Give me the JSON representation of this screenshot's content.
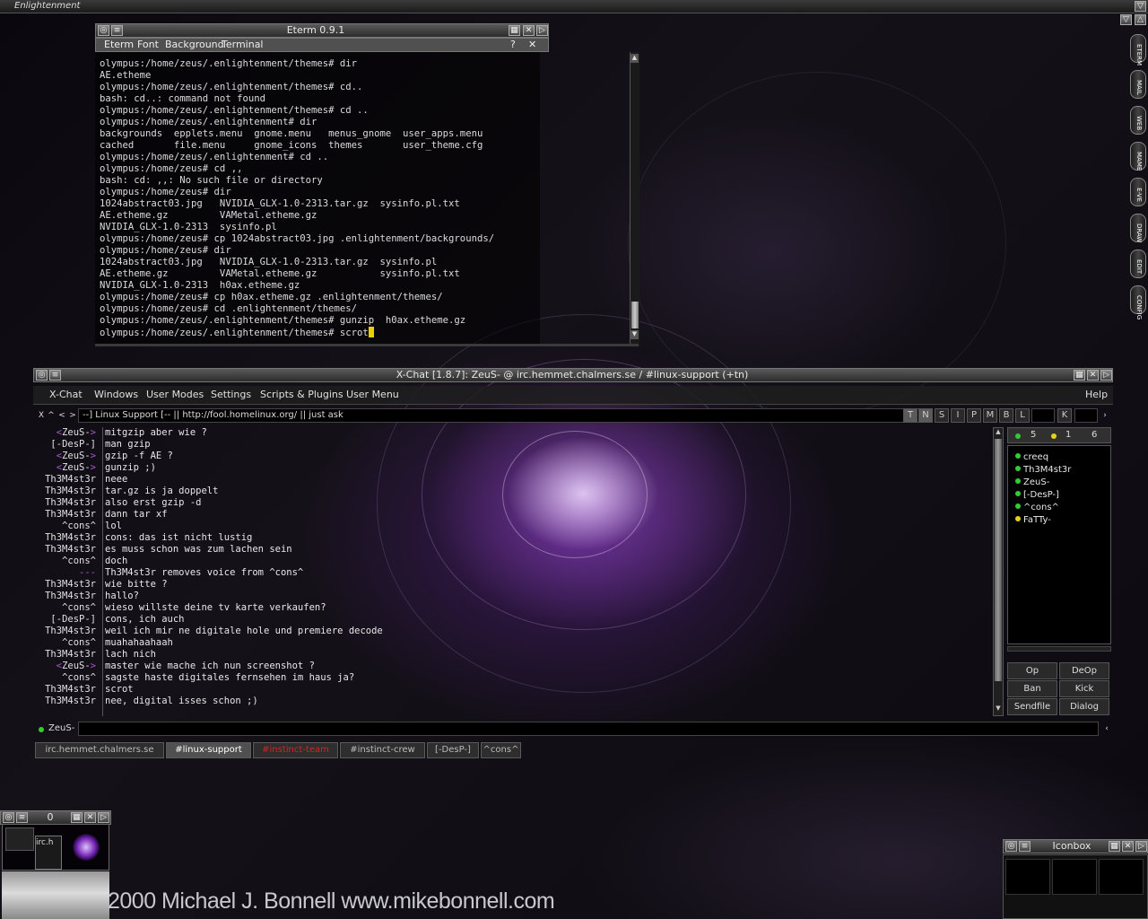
{
  "desktop": {
    "title": "Enlightenment",
    "copyright": "2000 Michael J. Bonnell  www.mikebonnell.com"
  },
  "eterm": {
    "title": "Eterm 0.9.1",
    "menu": [
      "Eterm",
      "Font",
      "Background",
      "Terminal"
    ],
    "menu_help": "?",
    "lines": [
      "olympus:/home/zeus/.enlightenment/themes# dir",
      "AE.etheme",
      "olympus:/home/zeus/.enlightenment/themes# cd..",
      "bash: cd..: command not found",
      "olympus:/home/zeus/.enlightenment/themes# cd ..",
      "olympus:/home/zeus/.enlightenment# dir",
      "backgrounds  epplets.menu  gnome.menu   menus_gnome  user_apps.menu",
      "cached       file.menu     gnome_icons  themes       user_theme.cfg",
      "olympus:/home/zeus/.enlightenment# cd ..",
      "olympus:/home/zeus# cd ,,",
      "bash: cd: ,,: No such file or directory",
      "olympus:/home/zeus# dir",
      "1024abstract03.jpg   NVIDIA_GLX-1.0-2313.tar.gz  sysinfo.pl.txt",
      "AE.etheme.gz         VAMetal.etheme.gz",
      "NVIDIA_GLX-1.0-2313  sysinfo.pl",
      "olympus:/home/zeus# cp 1024abstract03.jpg .enlightenment/backgrounds/",
      "olympus:/home/zeus# dir",
      "1024abstract03.jpg   NVIDIA_GLX-1.0-2313.tar.gz  sysinfo.pl",
      "AE.etheme.gz         VAMetal.etheme.gz           sysinfo.pl.txt",
      "NVIDIA_GLX-1.0-2313  h0ax.etheme.gz",
      "olympus:/home/zeus# cp h0ax.etheme.gz .enlightenment/themes/",
      "olympus:/home/zeus# cd .enlightenment/themes/",
      "olympus:/home/zeus/.enlightenment/themes# gunzip  h0ax.etheme.gz",
      "olympus:/home/zeus/.enlightenment/themes# scrot"
    ]
  },
  "xchat": {
    "title": "X-Chat [1.8.7]: ZeuS- @ irc.hemmet.chalmers.se / #linux-support (+tn)",
    "menu": [
      "X-Chat",
      "Windows",
      "User Modes",
      "Settings",
      "Scripts & Plugins",
      "User Menu"
    ],
    "help": "Help",
    "nav": [
      "X",
      "^",
      "<",
      ">"
    ],
    "topic": "--] Linux Support [-- || http://fool.homelinux.org/ || just ask",
    "modes": [
      "T",
      "N",
      "S",
      "I",
      "P",
      "M",
      "B",
      "L"
    ],
    "key_mode": "K",
    "messages": [
      {
        "nick": "ZeuS-",
        "angle": true,
        "text": "mitgzip aber wie ?"
      },
      {
        "nick": "[-DesP-]",
        "angle": false,
        "text": "man gzip"
      },
      {
        "nick": "ZeuS-",
        "angle": true,
        "text": "gzip -f AE ?"
      },
      {
        "nick": "ZeuS-",
        "angle": true,
        "text": "gunzip ;)"
      },
      {
        "nick": "Th3M4st3r",
        "angle": false,
        "text": "neee"
      },
      {
        "nick": "Th3M4st3r",
        "angle": false,
        "text": "tar.gz is ja doppelt"
      },
      {
        "nick": "Th3M4st3r",
        "angle": false,
        "text": "also erst gzip -d"
      },
      {
        "nick": "Th3M4st3r",
        "angle": false,
        "text": "dann tar xf"
      },
      {
        "nick": "^cons^",
        "angle": false,
        "text": "lol"
      },
      {
        "nick": "Th3M4st3r",
        "angle": false,
        "text": "cons: das ist nicht lustig"
      },
      {
        "nick": "Th3M4st3r",
        "angle": false,
        "text": "es muss schon was zum lachen sein"
      },
      {
        "nick": "^cons^",
        "angle": false,
        "text": "doch"
      },
      {
        "nick": "---",
        "angle": false,
        "text": "Th3M4st3r removes voice from ^cons^"
      },
      {
        "nick": "Th3M4st3r",
        "angle": false,
        "text": "wie bitte ?"
      },
      {
        "nick": "Th3M4st3r",
        "angle": false,
        "text": "hallo?"
      },
      {
        "nick": "^cons^",
        "angle": false,
        "text": "wieso willste deine tv karte verkaufen?"
      },
      {
        "nick": "[-DesP-]",
        "angle": false,
        "text": "cons, ich auch"
      },
      {
        "nick": "Th3M4st3r",
        "angle": false,
        "text": "weil ich mir ne digitale hole und premiere decode"
      },
      {
        "nick": "^cons^",
        "angle": false,
        "text": "muahahaahaah"
      },
      {
        "nick": "Th3M4st3r",
        "angle": false,
        "text": "lach nich"
      },
      {
        "nick": "ZeuS-",
        "angle": true,
        "text": "master wie mache ich nun screenshot ?"
      },
      {
        "nick": "^cons^",
        "angle": false,
        "text": "sagste haste digitales fernsehen im haus ja?"
      },
      {
        "nick": "Th3M4st3r",
        "angle": false,
        "text": "scrot"
      },
      {
        "nick": "Th3M4st3r",
        "angle": false,
        "text": "nee, digital isses schon ;)"
      }
    ],
    "counts": [
      "5",
      "1",
      "6"
    ],
    "users": [
      {
        "name": "creeq",
        "status": "op"
      },
      {
        "name": "Th3M4st3r",
        "status": "op"
      },
      {
        "name": "ZeuS-",
        "status": "op"
      },
      {
        "name": "[-DesP-]",
        "status": "op"
      },
      {
        "name": "^cons^",
        "status": "op"
      },
      {
        "name": "FaTTy-",
        "status": "voice"
      }
    ],
    "buttons": [
      "Op",
      "DeOp",
      "Ban",
      "Kick",
      "Sendfile",
      "Dialog"
    ],
    "input_nick": "ZeuS-",
    "tabs": [
      {
        "label": "irc.hemmet.chalmers.se",
        "state": "normal"
      },
      {
        "label": "#linux-support",
        "state": "active"
      },
      {
        "label": "#instinct-team",
        "state": "alert"
      },
      {
        "label": "#instinct-crew",
        "state": "normal"
      },
      {
        "label": "[-DesP-]",
        "state": "normal"
      },
      {
        "label": "^cons^",
        "state": "normal"
      }
    ],
    "colors": {
      "op": "#33cc33",
      "voice": "#e8d020",
      "alert": "#dd2020",
      "nick_angle": "#aa55cc"
    }
  },
  "dock": [
    "ETERM",
    "MAIL",
    "WEB",
    "MAME",
    "E-VE",
    "DRAW",
    "EDIT",
    "CONFIG"
  ],
  "pager": {
    "title": "0",
    "thumb_label": "irc.h"
  },
  "iconbox": {
    "title": "Iconbox"
  }
}
